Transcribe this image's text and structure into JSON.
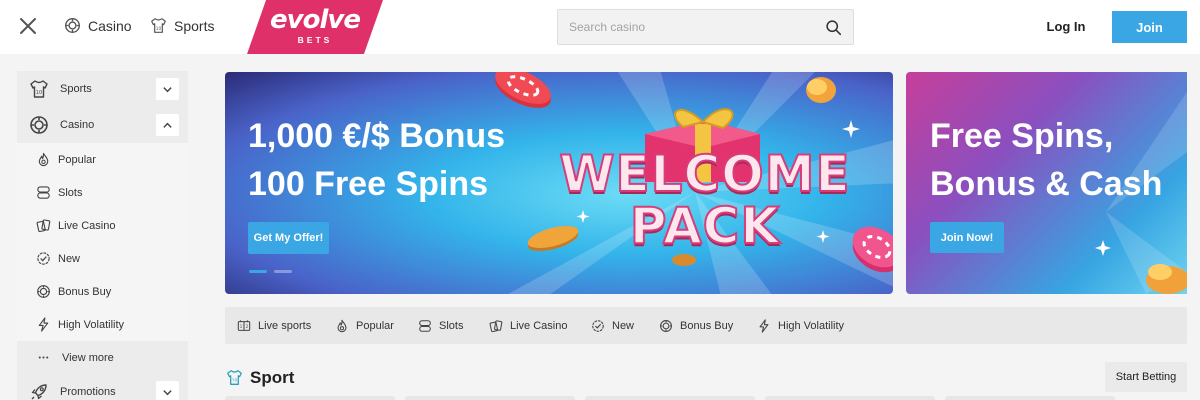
{
  "header": {
    "nav": [
      {
        "label": "Casino",
        "icon": "casino-chip-icon"
      },
      {
        "label": "Sports",
        "icon": "jersey-icon"
      }
    ],
    "logo": {
      "word": "evolve",
      "sub": "BETS",
      "color": "#e0306a"
    },
    "search": {
      "placeholder": "Search casino",
      "value": ""
    },
    "login_label": "Log In",
    "join_label": "Join",
    "accent": "#3aa6e4"
  },
  "sidebar": {
    "sections": [
      {
        "label": "Sports",
        "icon": "jersey-icon",
        "expanded": false
      },
      {
        "label": "Casino",
        "icon": "casino-chip-icon",
        "expanded": true
      },
      {
        "label": "Promotions",
        "icon": "rocket-icon",
        "expanded": false
      }
    ],
    "casino_items": [
      {
        "label": "Popular",
        "icon": "flame-icon"
      },
      {
        "label": "Slots",
        "icon": "slots-icon"
      },
      {
        "label": "Live Casino",
        "icon": "cards-icon"
      },
      {
        "label": "New",
        "icon": "check-badge-icon"
      },
      {
        "label": "Bonus Buy",
        "icon": "chip-icon"
      },
      {
        "label": "High Volatility",
        "icon": "lightning-icon"
      }
    ],
    "view_more_label": "View more"
  },
  "banners": [
    {
      "line1": "1,000 €/$ Bonus",
      "line2": "100 Free Spins",
      "cta": "Get My Offer!",
      "art_line1": "WELCOME",
      "art_line2": "PACK"
    },
    {
      "line1": "Free Spins,",
      "line2": "Bonus & Cash",
      "cta": "Join Now!"
    }
  ],
  "carousel": {
    "active_index": 0,
    "count": 2
  },
  "categories": [
    {
      "label": "Live sports",
      "icon": "scoreboard-icon"
    },
    {
      "label": "Popular",
      "icon": "flame-icon"
    },
    {
      "label": "Slots",
      "icon": "slots-icon"
    },
    {
      "label": "Live Casino",
      "icon": "cards-icon"
    },
    {
      "label": "New",
      "icon": "check-badge-icon"
    },
    {
      "label": "Bonus Buy",
      "icon": "chip-icon"
    },
    {
      "label": "High Volatility",
      "icon": "lightning-icon"
    }
  ],
  "section": {
    "title": "Sport",
    "icon": "jersey-icon",
    "action_label": "Start Betting"
  }
}
